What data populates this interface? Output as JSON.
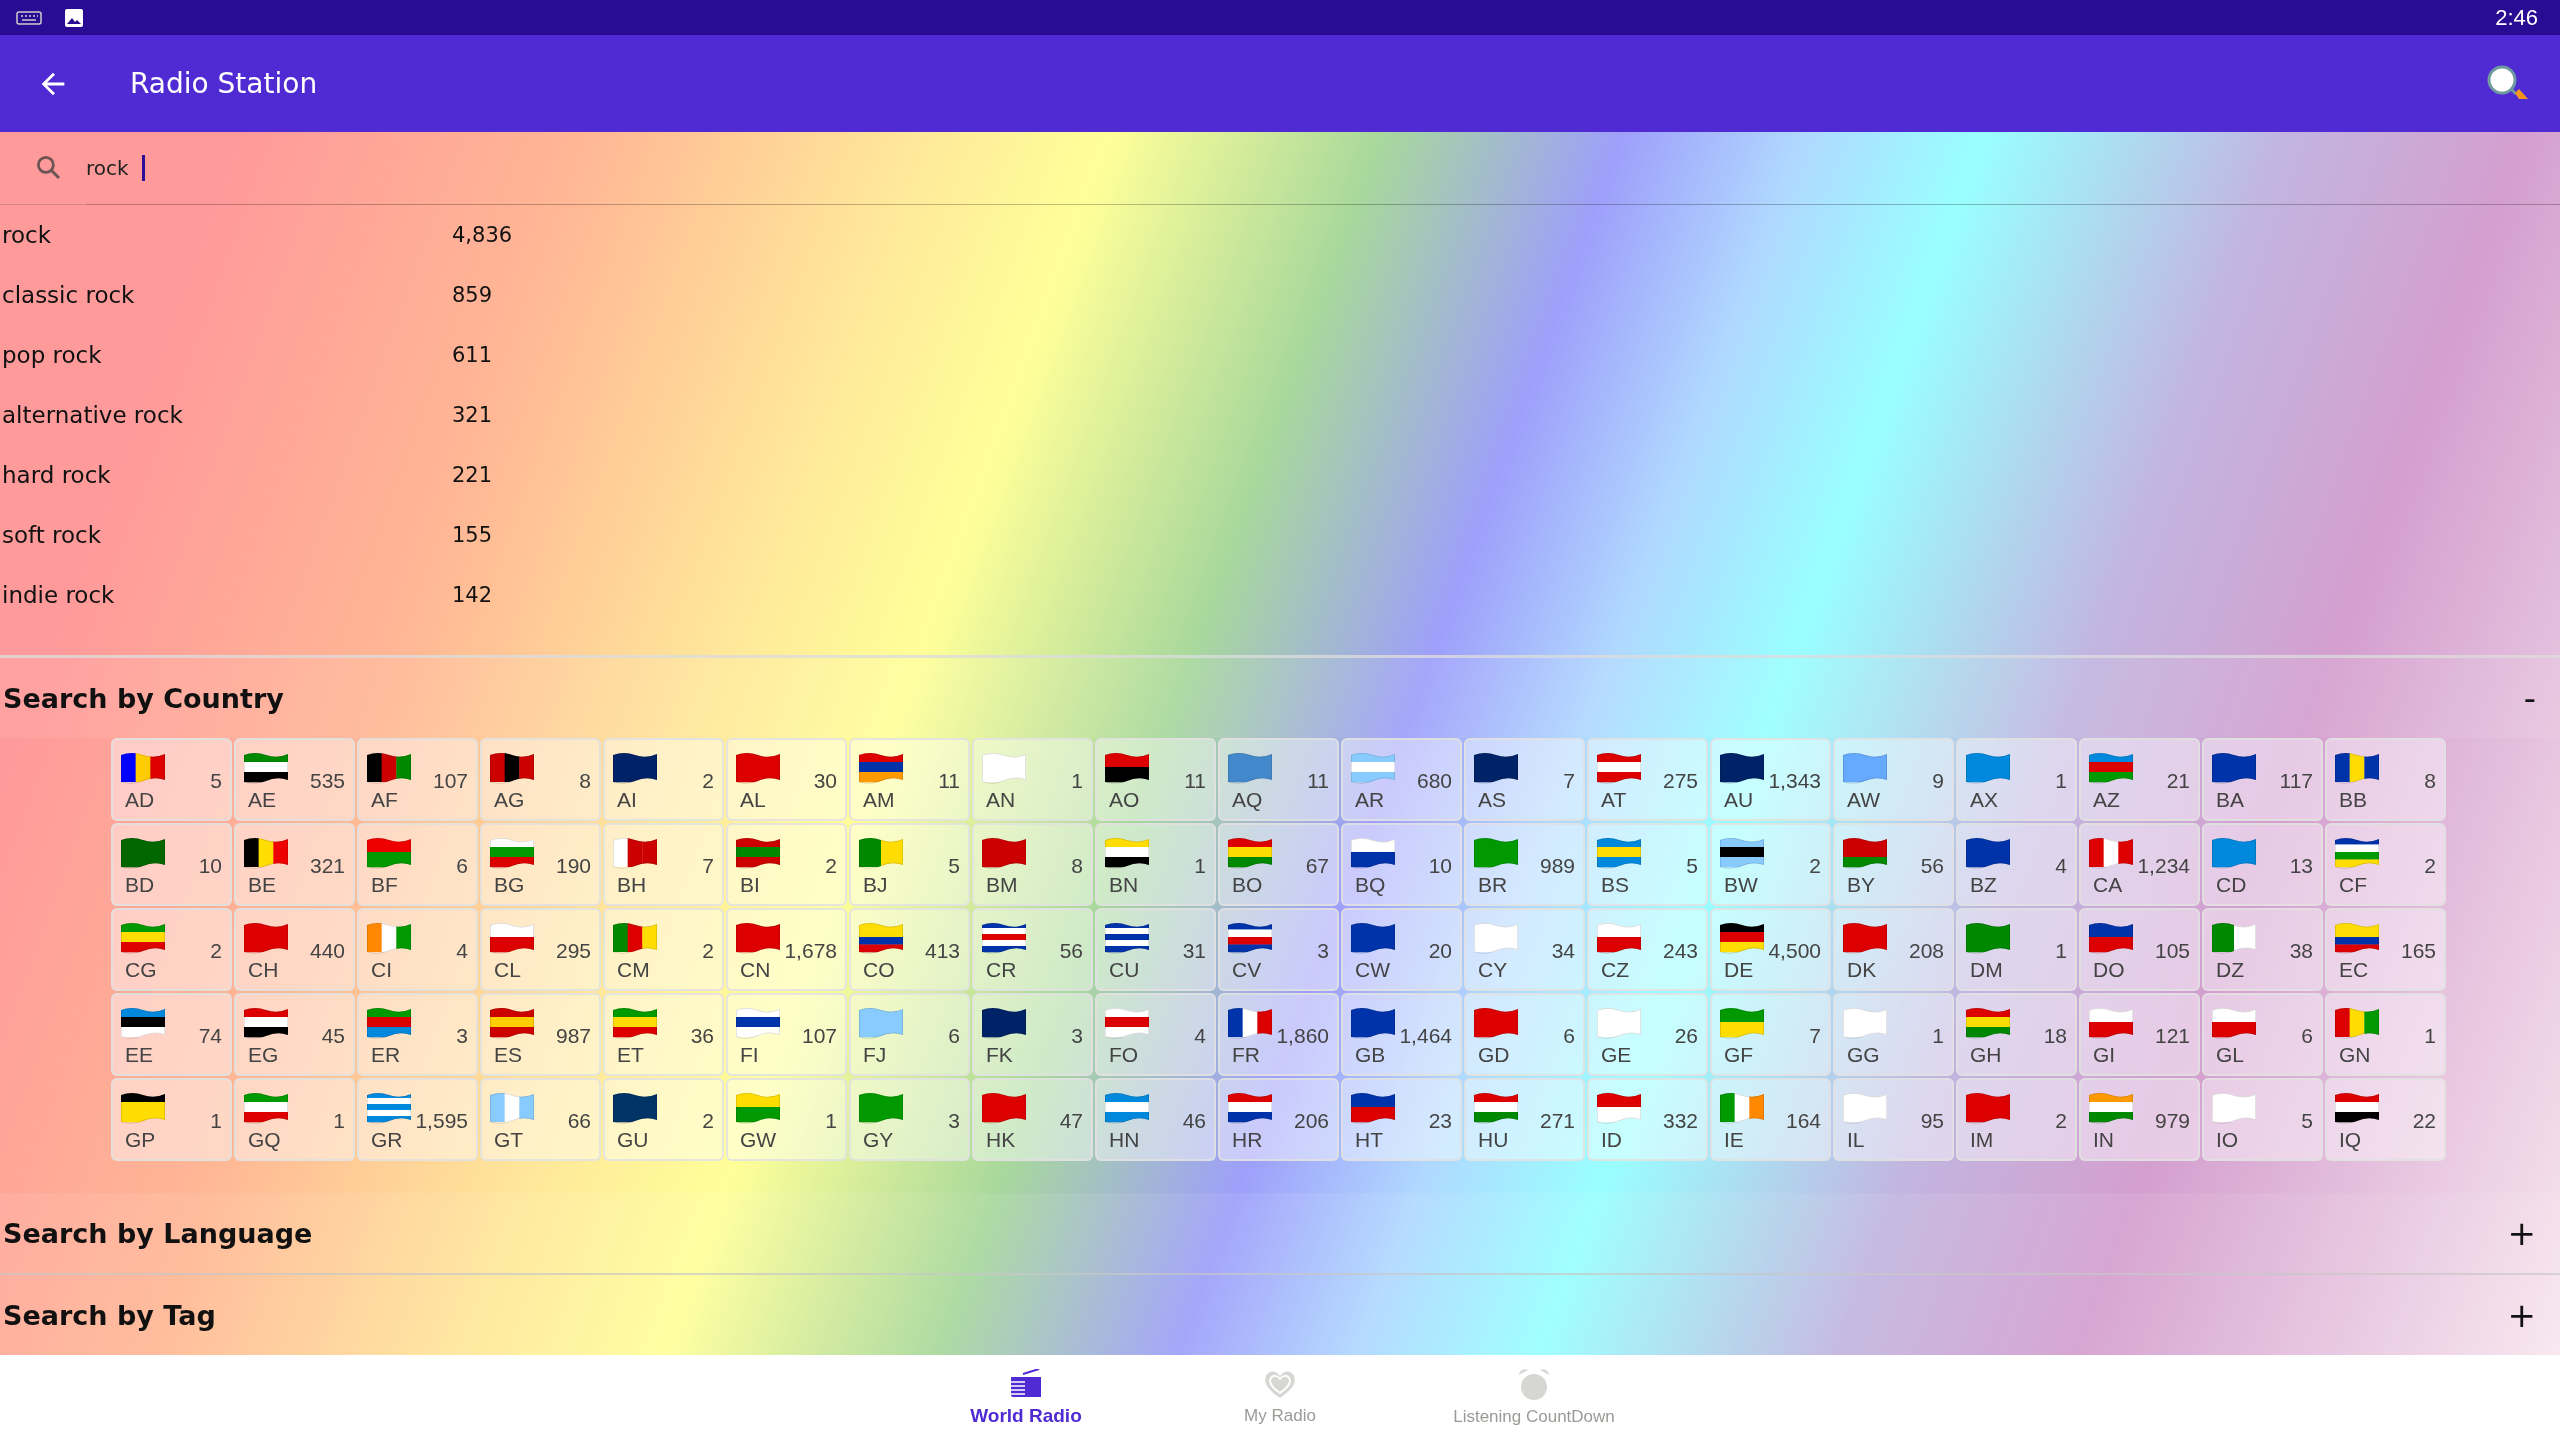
{
  "status_bar": {
    "time": "2:46"
  },
  "app_bar": {
    "title": "Radio Station"
  },
  "search": {
    "value": "rock",
    "focused": true
  },
  "tag_results": [
    {
      "name": "rock",
      "count": "4,836"
    },
    {
      "name": "classic rock",
      "count": "859"
    },
    {
      "name": "pop rock",
      "count": "611"
    },
    {
      "name": "alternative rock",
      "count": "321"
    },
    {
      "name": "hard rock",
      "count": "221"
    },
    {
      "name": "soft rock",
      "count": "155"
    },
    {
      "name": "indie rock",
      "count": "142"
    }
  ],
  "sections": [
    {
      "title": "Search by Country",
      "toggle": "-"
    },
    {
      "title": "Search by Language",
      "toggle": "+"
    },
    {
      "title": "Search by Tag",
      "toggle": "+"
    }
  ],
  "countries": [
    {
      "code": "AD",
      "count": "5"
    },
    {
      "code": "AE",
      "count": "535"
    },
    {
      "code": "AF",
      "count": "107"
    },
    {
      "code": "AG",
      "count": "8"
    },
    {
      "code": "AI",
      "count": "2"
    },
    {
      "code": "AL",
      "count": "30"
    },
    {
      "code": "AM",
      "count": "11"
    },
    {
      "code": "AN",
      "count": "1"
    },
    {
      "code": "AO",
      "count": "11"
    },
    {
      "code": "AQ",
      "count": "11"
    },
    {
      "code": "AR",
      "count": "680"
    },
    {
      "code": "AS",
      "count": "7"
    },
    {
      "code": "AT",
      "count": "275"
    },
    {
      "code": "AU",
      "count": "1,343"
    },
    {
      "code": "AW",
      "count": "9"
    },
    {
      "code": "AX",
      "count": "1"
    },
    {
      "code": "AZ",
      "count": "21"
    },
    {
      "code": "BA",
      "count": "117"
    },
    {
      "code": "BB",
      "count": "8"
    },
    {
      "code": "BD",
      "count": "10"
    },
    {
      "code": "BE",
      "count": "321"
    },
    {
      "code": "BF",
      "count": "6"
    },
    {
      "code": "BG",
      "count": "190"
    },
    {
      "code": "BH",
      "count": "7"
    },
    {
      "code": "BI",
      "count": "2"
    },
    {
      "code": "BJ",
      "count": "5"
    },
    {
      "code": "BM",
      "count": "8"
    },
    {
      "code": "BN",
      "count": "1"
    },
    {
      "code": "BO",
      "count": "67"
    },
    {
      "code": "BQ",
      "count": "10"
    },
    {
      "code": "BR",
      "count": "989"
    },
    {
      "code": "BS",
      "count": "5"
    },
    {
      "code": "BW",
      "count": "2"
    },
    {
      "code": "BY",
      "count": "56"
    },
    {
      "code": "BZ",
      "count": "4"
    },
    {
      "code": "CA",
      "count": "1,234"
    },
    {
      "code": "CD",
      "count": "13"
    },
    {
      "code": "CF",
      "count": "2"
    },
    {
      "code": "CG",
      "count": "2"
    },
    {
      "code": "CH",
      "count": "440"
    },
    {
      "code": "CI",
      "count": "4"
    },
    {
      "code": "CL",
      "count": "295"
    },
    {
      "code": "CM",
      "count": "2"
    },
    {
      "code": "CN",
      "count": "1,678"
    },
    {
      "code": "CO",
      "count": "413"
    },
    {
      "code": "CR",
      "count": "56"
    },
    {
      "code": "CU",
      "count": "31"
    },
    {
      "code": "CV",
      "count": "3"
    },
    {
      "code": "CW",
      "count": "20"
    },
    {
      "code": "CY",
      "count": "34"
    },
    {
      "code": "CZ",
      "count": "243"
    },
    {
      "code": "DE",
      "count": "4,500"
    },
    {
      "code": "DK",
      "count": "208"
    },
    {
      "code": "DM",
      "count": "1"
    },
    {
      "code": "DO",
      "count": "105"
    },
    {
      "code": "DZ",
      "count": "38"
    },
    {
      "code": "EC",
      "count": "165"
    },
    {
      "code": "EE",
      "count": "74"
    },
    {
      "code": "EG",
      "count": "45"
    },
    {
      "code": "ER",
      "count": "3"
    },
    {
      "code": "ES",
      "count": "987"
    },
    {
      "code": "ET",
      "count": "36"
    },
    {
      "code": "FI",
      "count": "107"
    },
    {
      "code": "FJ",
      "count": "6"
    },
    {
      "code": "FK",
      "count": "3"
    },
    {
      "code": "FO",
      "count": "4"
    },
    {
      "code": "FR",
      "count": "1,860"
    },
    {
      "code": "GB",
      "count": "1,464"
    },
    {
      "code": "GD",
      "count": "6"
    },
    {
      "code": "GE",
      "count": "26"
    },
    {
      "code": "GF",
      "count": "7"
    },
    {
      "code": "GG",
      "count": "1"
    },
    {
      "code": "GH",
      "count": "18"
    },
    {
      "code": "GI",
      "count": "121"
    },
    {
      "code": "GL",
      "count": "6"
    },
    {
      "code": "GN",
      "count": "1"
    },
    {
      "code": "GP",
      "count": "1"
    },
    {
      "code": "GQ",
      "count": "1"
    },
    {
      "code": "GR",
      "count": "1,595"
    },
    {
      "code": "GT",
      "count": "66"
    },
    {
      "code": "GU",
      "count": "2"
    },
    {
      "code": "GW",
      "count": "1"
    },
    {
      "code": "GY",
      "count": "3"
    },
    {
      "code": "HK",
      "count": "47"
    },
    {
      "code": "HN",
      "count": "46"
    },
    {
      "code": "HR",
      "count": "206"
    },
    {
      "code": "HT",
      "count": "23"
    },
    {
      "code": "HU",
      "count": "271"
    },
    {
      "code": "ID",
      "count": "332"
    },
    {
      "code": "IE",
      "count": "164"
    },
    {
      "code": "IL",
      "count": "95"
    },
    {
      "code": "IM",
      "count": "2"
    },
    {
      "code": "IN",
      "count": "979"
    },
    {
      "code": "IO",
      "count": "5"
    },
    {
      "code": "IQ",
      "count": "22"
    }
  ],
  "bottom_nav": [
    {
      "label": "World Radio",
      "selected": true
    },
    {
      "label": "My Radio",
      "selected": false
    },
    {
      "label": "Listening CountDown",
      "selected": false
    }
  ]
}
